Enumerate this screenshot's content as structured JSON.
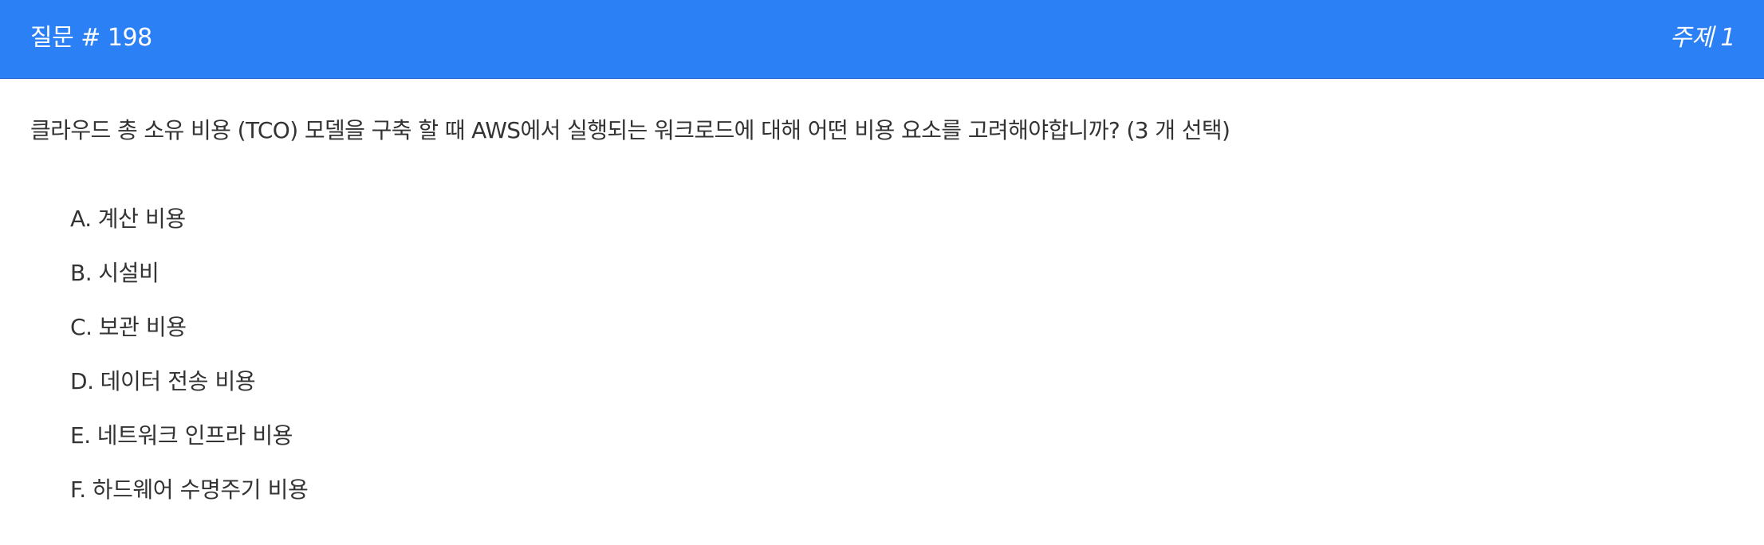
{
  "header": {
    "title": "질문 # 198",
    "topic": "주제 1"
  },
  "question": {
    "text": "클라우드 총 소유 비용 (TCO) 모델을 구축 할 때 AWS에서 실행되는 워크로드에 대해 어떤 비용 요소를 고려해야합니까? (3 개 선택)"
  },
  "options": [
    {
      "letter": "A.",
      "text": "계산 비용"
    },
    {
      "letter": "B.",
      "text": "시설비"
    },
    {
      "letter": "C.",
      "text": "보관 비용"
    },
    {
      "letter": "D.",
      "text": "데이터 전송 비용"
    },
    {
      "letter": "E.",
      "text": "네트워크 인프라 비용"
    },
    {
      "letter": "F.",
      "text": "하드웨어 수명주기 비용"
    }
  ],
  "colors": {
    "header_bg": "#2c80f6",
    "header_text": "#ffffff",
    "body_text": "#333333"
  }
}
